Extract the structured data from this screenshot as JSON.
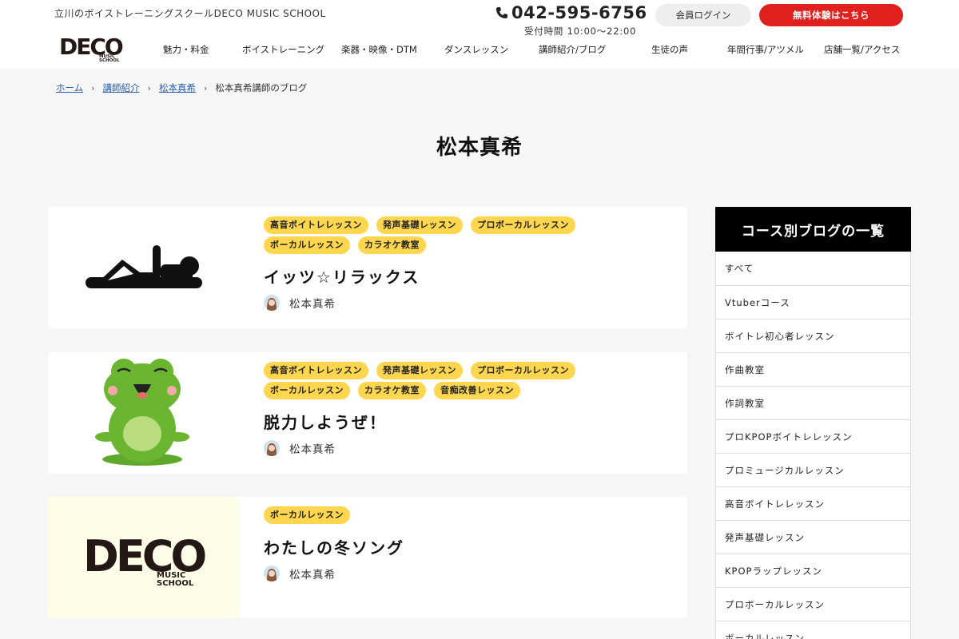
{
  "header": {
    "tagline": "立川のボイストレーニングスクールDECO MUSIC SCHOOL",
    "logo_text": "DECO MUSIC SCHOOL",
    "phone": "042-595-6756",
    "hours": "受付時間 10:00〜22:00",
    "login_label": "会員ログイン",
    "trial_label": "無料体験はこちら",
    "accent_color": "#e0201e"
  },
  "nav": [
    "魅力・料金",
    "ボイストレーニング",
    "楽器・映像・DTM",
    "ダンスレッスン",
    "講師紹介/ブログ",
    "生徒の声",
    "年間行事/アツメル",
    "店舗一覧/アクセス"
  ],
  "breadcrumb": {
    "home": "ホーム",
    "teachers": "講師紹介",
    "teacher": "松本真希",
    "current": "松本真希講師のブログ"
  },
  "page_title": "松本真希",
  "posts": [
    {
      "tags": [
        "高音ボイトレレッスン",
        "発声基礎レッスン",
        "プロボーカルレッスン",
        "ボーカルレッスン",
        "カラオケ教室"
      ],
      "title": "イッツ☆リラックス",
      "author": "松本真希",
      "thumb": "relaxing-person-illustration"
    },
    {
      "tags": [
        "高音ボイトレレッスン",
        "発声基礎レッスン",
        "プロボーカルレッスン",
        "ボーカルレッスン",
        "カラオケ教室",
        "音痴改善レッスン"
      ],
      "title": "脱力しようぜ！",
      "author": "松本真希",
      "thumb": "frog-illustration"
    },
    {
      "tags": [
        "ボーカルレッスン"
      ],
      "title": "わたしの冬ソング",
      "author": "松本真希",
      "thumb": "deco-logo"
    }
  ],
  "sidebar": {
    "heading": "コース別ブログの一覧",
    "items": [
      "すべて",
      "Vtuberコース",
      "ボイトレ初心者レッスン",
      "作曲教室",
      "作詞教室",
      "プロKPOPボイトレレッスン",
      "プロミュージカルレッスン",
      "高音ボイトレレッスン",
      "発声基礎レッスン",
      "KPOPラップレッスン",
      "プロボーカルレッスン",
      "ボーカルレッスン"
    ]
  },
  "colors": {
    "tag_bg": "#ffd64d",
    "link": "#2a5db0",
    "sidebar_head_bg": "#000000"
  }
}
